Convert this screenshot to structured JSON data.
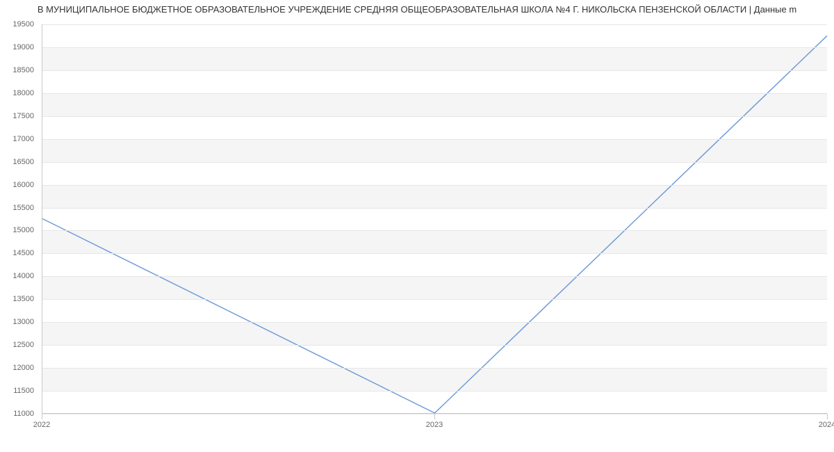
{
  "title": "В МУНИЦИПАЛЬНОЕ БЮДЖЕТНОЕ ОБРАЗОВАТЕЛЬНОЕ УЧРЕЖДЕНИЕ СРЕДНЯЯ ОБЩЕОБРАЗОВАТЕЛЬНАЯ ШКОЛА №4 Г. НИКОЛЬСКА ПЕНЗЕНСКОЙ ОБЛАСТИ | Данные m",
  "chart_data": {
    "type": "line",
    "categories": [
      "2022",
      "2023",
      "2024"
    ],
    "values": [
      15250,
      11000,
      19250
    ],
    "title": "В МУНИЦИПАЛЬНОЕ БЮДЖЕТНОЕ ОБРАЗОВАТЕЛЬНОЕ УЧРЕЖДЕНИЕ СРЕДНЯЯ ОБЩЕОБРАЗОВАТЕЛЬНАЯ ШКОЛА №4 Г. НИКОЛЬСКА ПЕНЗЕНСКОЙ ОБЛАСТИ | Данные m",
    "xlabel": "",
    "ylabel": "",
    "ylim": [
      11000,
      19500
    ],
    "y_ticks": [
      11000,
      11500,
      12000,
      12500,
      13000,
      13500,
      14000,
      14500,
      15000,
      15500,
      16000,
      16500,
      17000,
      17500,
      18000,
      18500,
      19000,
      19500
    ],
    "line_color": "#6f9bd8"
  }
}
